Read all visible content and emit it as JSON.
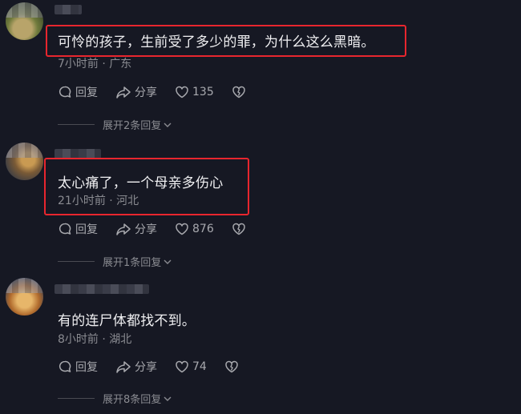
{
  "comments": [
    {
      "text": "可怜的孩子，生前受了多少的罪，为什么这么黑暗。",
      "meta": "7小时前 · 广东",
      "reply_label": "回复",
      "share_label": "分享",
      "like_count": "135",
      "expand_label": "展开2条回复"
    },
    {
      "text": "太心痛了，一个母亲多伤心",
      "meta": "21小时前 · 河北",
      "reply_label": "回复",
      "share_label": "分享",
      "like_count": "876",
      "expand_label": "展开1条回复"
    },
    {
      "text": "有的连尸体都找不到。",
      "meta": "8小时前 · 湖北",
      "reply_label": "回复",
      "share_label": "分享",
      "like_count": "74",
      "expand_label": "展开8条回复"
    }
  ],
  "colors": {
    "background": "#161823",
    "highlight": "#e8262e",
    "text": "#f0f0f2",
    "meta": "#8a8b91"
  },
  "icons": [
    "comment-icon",
    "share-icon",
    "heart-icon",
    "dislike-icon",
    "chevron-down-icon"
  ]
}
